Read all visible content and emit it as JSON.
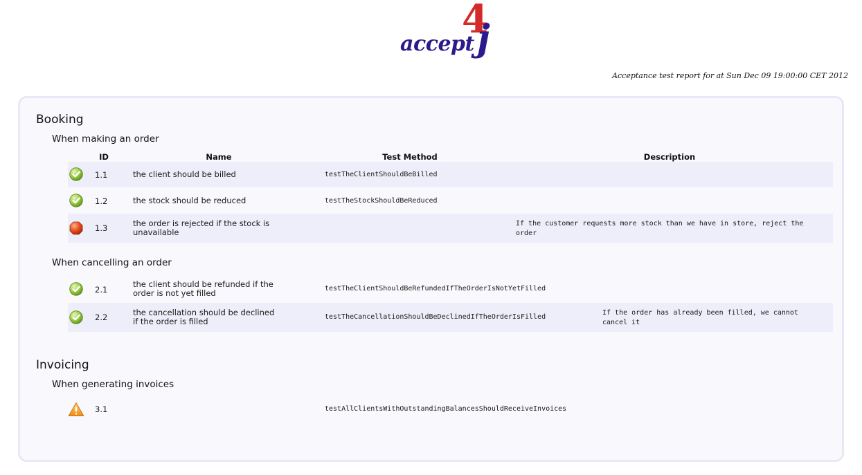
{
  "header": {
    "logo": {
      "word": "accept",
      "four": "4",
      "j": "j"
    },
    "report_meta": "Acceptance test report for at Sun Dec 09 19:00:00 CET 2012"
  },
  "columns": {
    "id": "ID",
    "name": "Name",
    "method": "Test Method",
    "description": "Description"
  },
  "colors": {
    "pass": "#7cb342",
    "fail": "#d84315",
    "warn": "#f5a623",
    "logo_blue": "#2a1a8c",
    "logo_red": "#d42a2a"
  },
  "sections": [
    {
      "title": "Booking",
      "groups": [
        {
          "title": "When making an order",
          "tests": [
            {
              "status_icon": "check-icon",
              "id": "1.1",
              "name": "the client should be billed",
              "method": "testTheClientShouldBeBilled",
              "description": ""
            },
            {
              "status_icon": "check-icon",
              "id": "1.2",
              "name": "the stock should be reduced",
              "method": "testTheStockShouldBeReduced",
              "description": ""
            },
            {
              "status_icon": "stop-icon",
              "id": "1.3",
              "name": "the order is rejected if the stock is unavailable",
              "method": "",
              "description": "If the customer requests more stock than we have in store, reject the order"
            }
          ]
        },
        {
          "title": "When cancelling an order",
          "tests": [
            {
              "status_icon": "check-icon",
              "id": "2.1",
              "name": "the client should be refunded if the order is not yet filled",
              "method": "testTheClientShouldBeRefundedIfTheOrderIsNotYetFilled",
              "description": ""
            },
            {
              "status_icon": "check-icon",
              "id": "2.2",
              "name": "the cancellation should be declined if the order is filled",
              "method": "testTheCancellationShouldBeDeclinedIfTheOrderIsFilled",
              "description": "If the order has already been filled, we cannot cancel it"
            }
          ]
        }
      ]
    },
    {
      "title": "Invoicing",
      "groups": [
        {
          "title": "When generating invoices",
          "tests": [
            {
              "status_icon": "warning-icon",
              "id": "3.1",
              "name": "",
              "method": "testAllClientsWithOutstandingBalancesShouldReceiveInvoices",
              "description": ""
            }
          ]
        }
      ]
    }
  ]
}
